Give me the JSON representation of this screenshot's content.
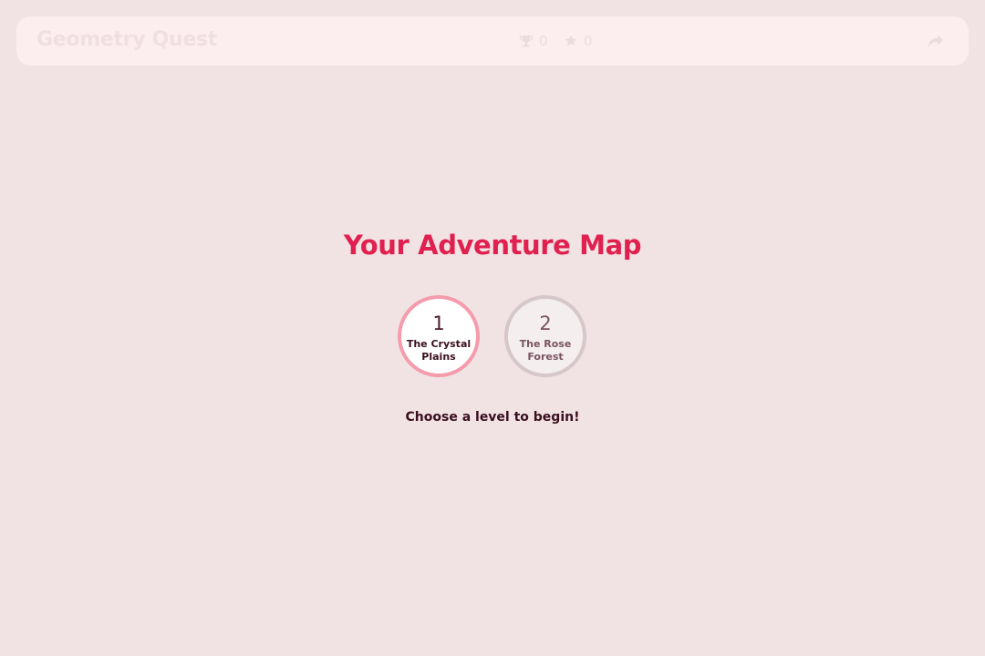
{
  "header": {
    "title": "Geometry Quest",
    "trophies": "0",
    "stars": "0",
    "trophy_icon": "trophy-icon",
    "star_icon": "star-icon",
    "share_icon": "share-icon"
  },
  "map": {
    "title": "Your Adventure Map",
    "hint": "Choose a level to begin!",
    "levels": [
      {
        "number": "1",
        "name": "The Crystal Plains"
      },
      {
        "number": "2",
        "name": "The Rose Forest"
      }
    ]
  },
  "colors": {
    "background": "#f1e3e4",
    "accent": "#e0204e",
    "level_active_border": "#f49cac",
    "level_locked_border": "#d5c7ca"
  }
}
